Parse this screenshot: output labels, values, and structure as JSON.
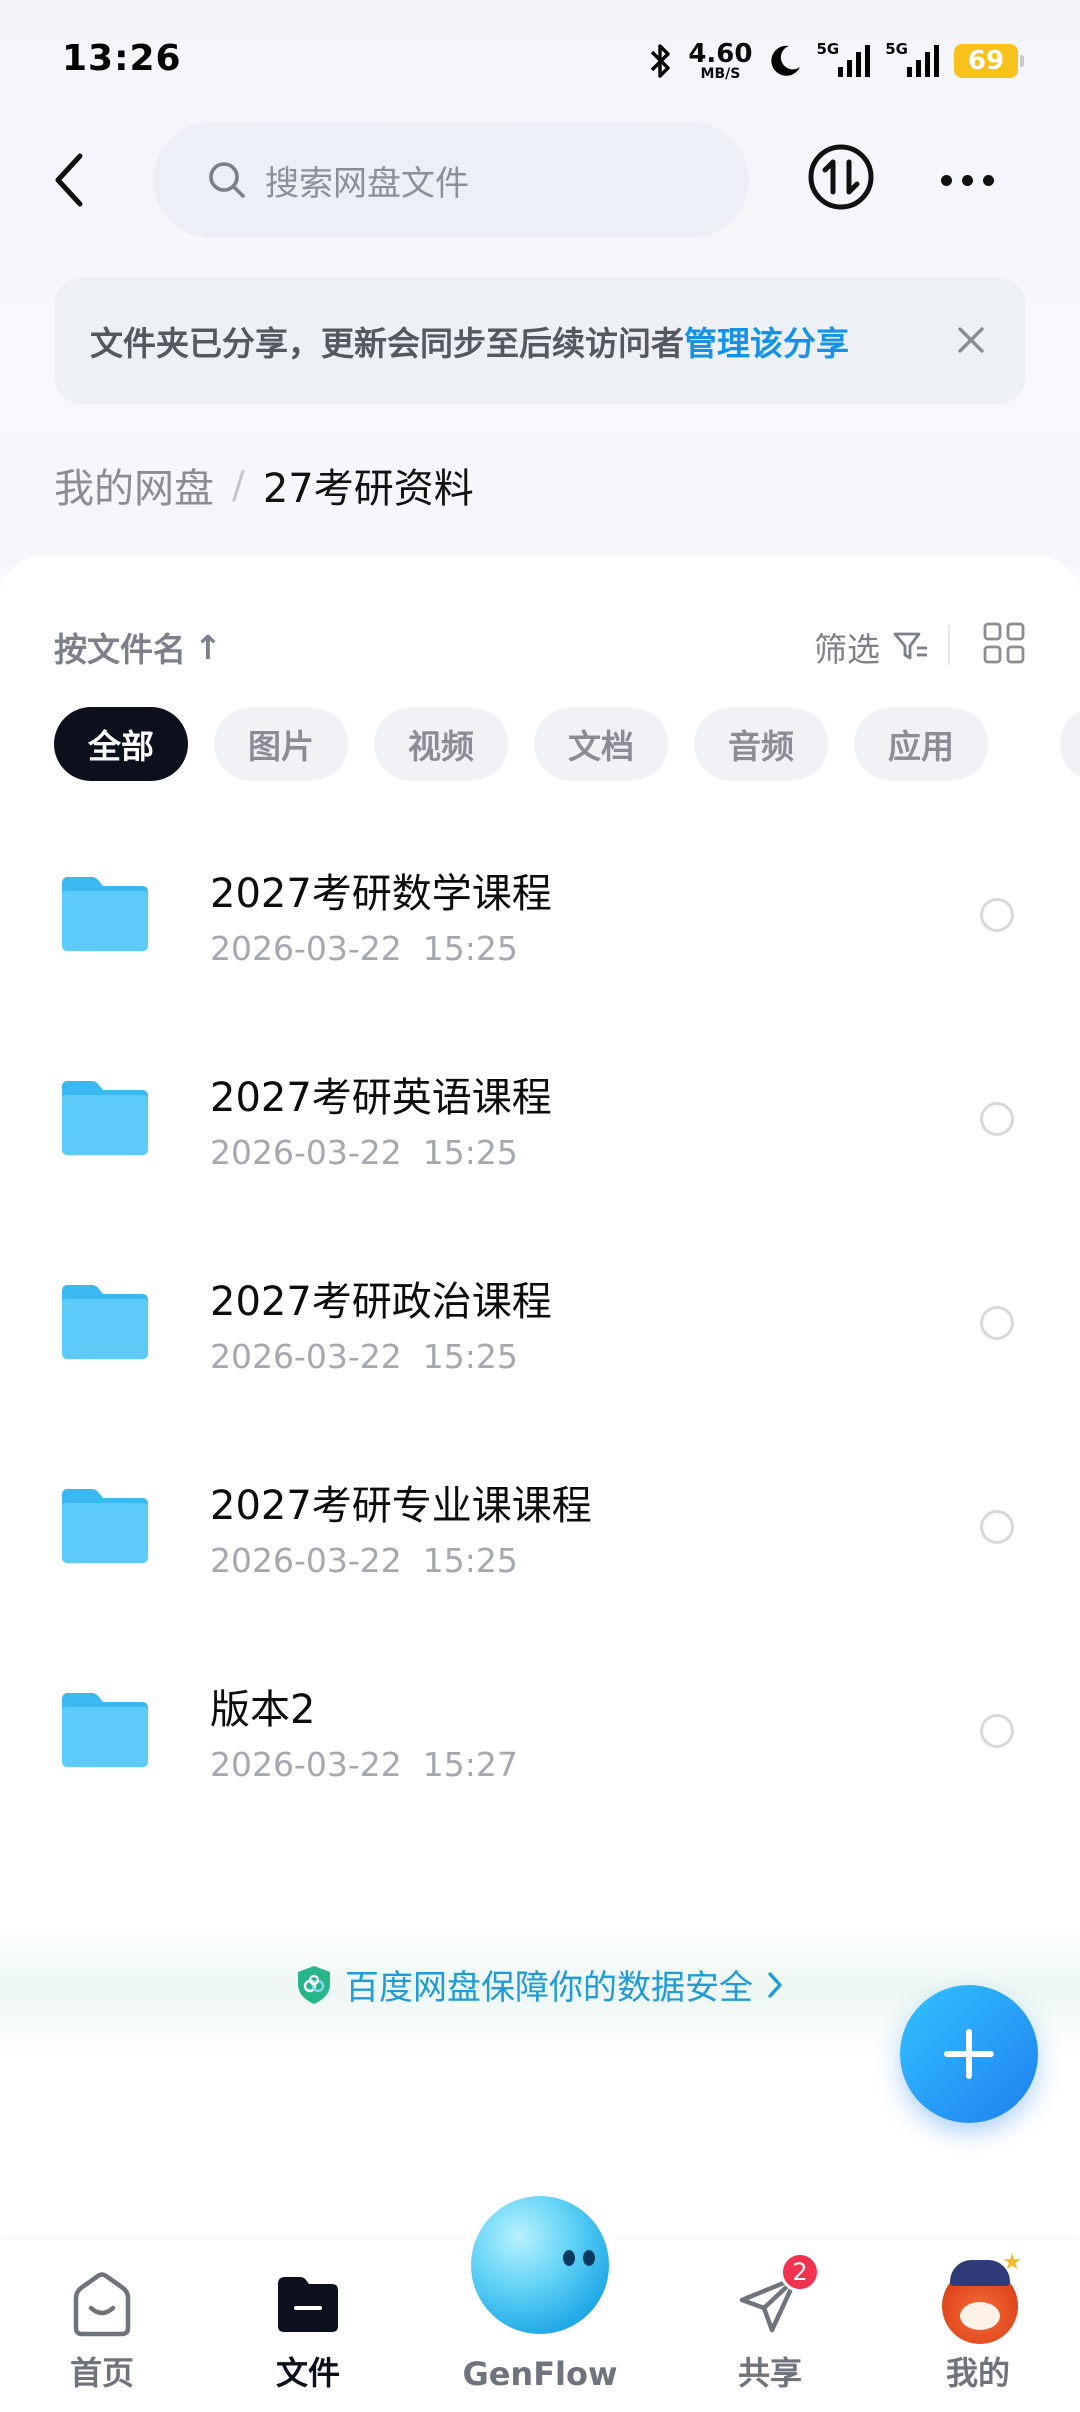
{
  "status_bar": {
    "time": "13:26",
    "net_speed_value": "4.60",
    "net_speed_unit": "MB/S",
    "signal1_label": "5G",
    "signal2_label": "5G",
    "battery": "69"
  },
  "header": {
    "search_placeholder": "搜索网盘文件"
  },
  "notice": {
    "text": "文件夹已分享，更新会同步至后续访问者",
    "link": "管理该分享"
  },
  "breadcrumb": {
    "root": "我的网盘",
    "separator": "/",
    "current": "27考研资料"
  },
  "sort": {
    "label": "按文件名",
    "arrow": "↑",
    "filter_label": "筛选"
  },
  "chips": [
    {
      "label": "全部",
      "active": true
    },
    {
      "label": "图片",
      "active": false
    },
    {
      "label": "视频",
      "active": false
    },
    {
      "label": "文档",
      "active": false
    },
    {
      "label": "音频",
      "active": false
    },
    {
      "label": "应用",
      "active": false
    }
  ],
  "files": [
    {
      "name": "2027考研数学课程",
      "date": "2026-03-22  15:25"
    },
    {
      "name": "2027考研英语课程",
      "date": "2026-03-22  15:25"
    },
    {
      "name": "2027考研政治课程",
      "date": "2026-03-22  15:25"
    },
    {
      "name": "2027考研专业课课程",
      "date": "2026-03-22  15:25"
    },
    {
      "name": "版本2",
      "date": "2026-03-22  15:27"
    }
  ],
  "safety_banner": "百度网盘保障你的数据安全",
  "tabs": {
    "home": "首页",
    "files": "文件",
    "genflow": "GenFlow",
    "share": "共享",
    "share_badge": "2",
    "mine": "我的"
  },
  "colors": {
    "accent": "#1493e6",
    "chip_active": "#0c0f1c",
    "folder": "#3fc0f5",
    "badge": "#f2334f"
  }
}
